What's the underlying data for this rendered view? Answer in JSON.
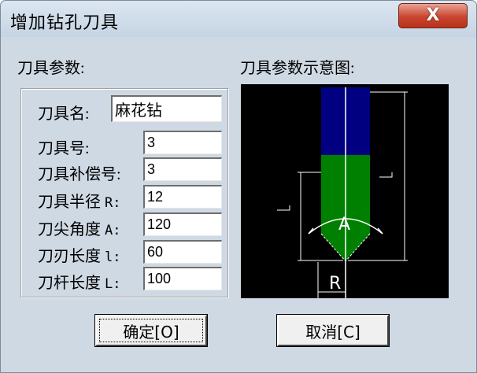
{
  "window": {
    "title": "增加钻孔刀具",
    "close_label": "X"
  },
  "params_section": {
    "title": "刀具参数:"
  },
  "preview_section": {
    "title": "刀具参数示意图:",
    "angle_label": "A",
    "radius_label": "R",
    "colors": {
      "shank": "#000080",
      "body": "#008000",
      "lines": "#ffffff"
    }
  },
  "fields": {
    "tool_name": {
      "label": "刀具名:",
      "value": "麻花钻"
    },
    "tool_number": {
      "label": "刀具号:",
      "value": "3"
    },
    "compensation_number": {
      "label": "刀具补偿号:",
      "value": "3"
    },
    "radius": {
      "label": "刀具半径",
      "suffix": "R:",
      "value": "12"
    },
    "tip_angle": {
      "label": "刀尖角度",
      "suffix": "A:",
      "value": "120"
    },
    "flute_length": {
      "label": "刀刃长度",
      "suffix": "l:",
      "value": "60"
    },
    "shank_length": {
      "label": "刀杆长度",
      "suffix": "L:",
      "value": "100"
    }
  },
  "buttons": {
    "ok": "确定[O]",
    "cancel": "取消[C]"
  }
}
